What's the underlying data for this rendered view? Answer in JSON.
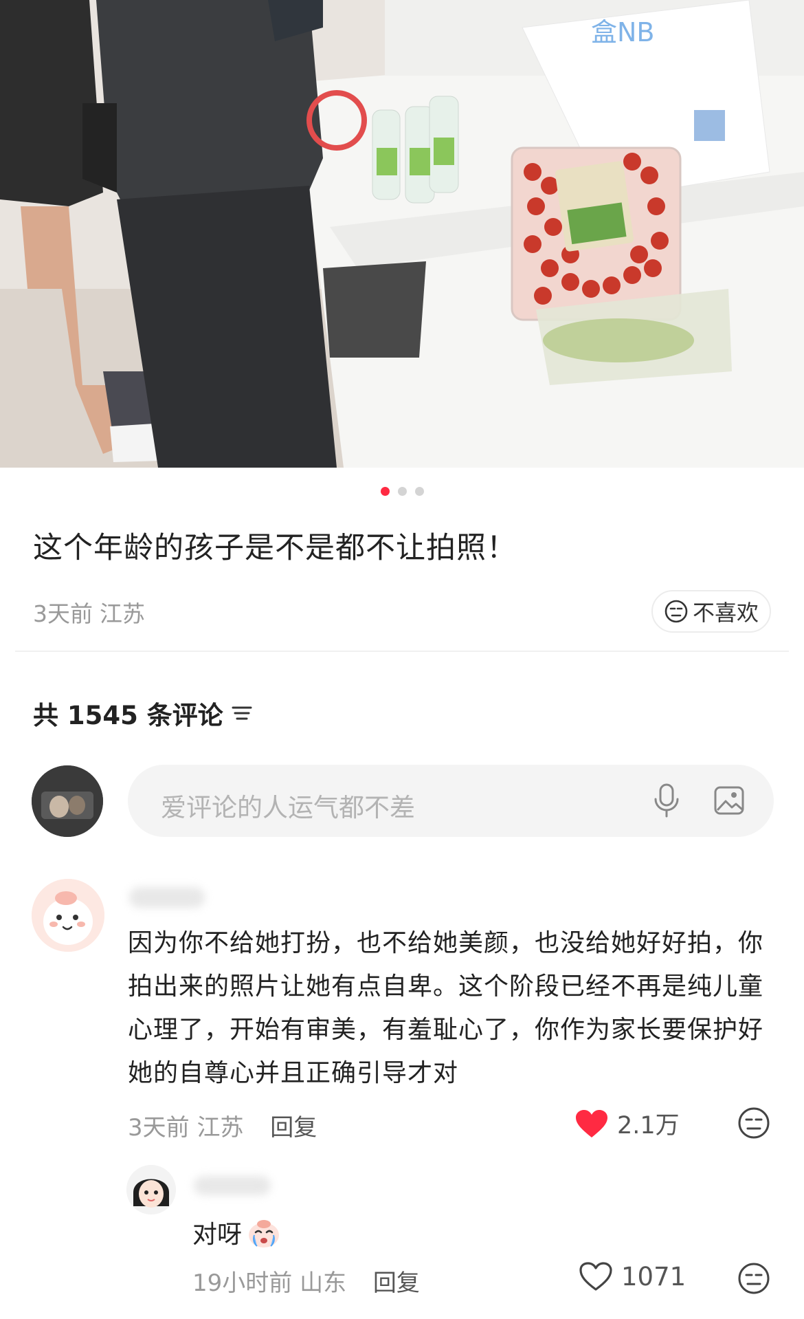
{
  "post": {
    "title": "这个年龄的孩子是不是都不让拍照！",
    "time": "3天前",
    "location": "江苏",
    "dislike_label": "不喜欢",
    "pager": {
      "count": 3,
      "active_index": 0
    }
  },
  "comments_header": {
    "label": "共 1545 条评论"
  },
  "comment_input": {
    "placeholder": "爱评论的人运气都不差"
  },
  "comments": [
    {
      "text": "因为你不给她打扮，也不给她美颜，也没给她好好拍，你拍出来的照片让她有点自卑。这个阶段已经不再是纯儿童心理了，开始有审美，有羞耻心了，你作为家长要保护好她的自尊心并且正确引导才对",
      "time": "3天前",
      "location": "江苏",
      "reply_label": "回复",
      "likes": "2.1万",
      "liked": true
    },
    {
      "text": "对呀",
      "time": "19小时前",
      "location": "山东",
      "reply_label": "回复",
      "likes": "1071",
      "liked": false
    }
  ],
  "colors": {
    "accent": "#ff2a42",
    "meta_text": "#999999",
    "input_bg": "#f4f4f4"
  },
  "icons": [
    "neutral-face-icon",
    "filter-lines-icon",
    "microphone-icon",
    "image-icon",
    "heart-icon",
    "crying-emoji-icon"
  ]
}
